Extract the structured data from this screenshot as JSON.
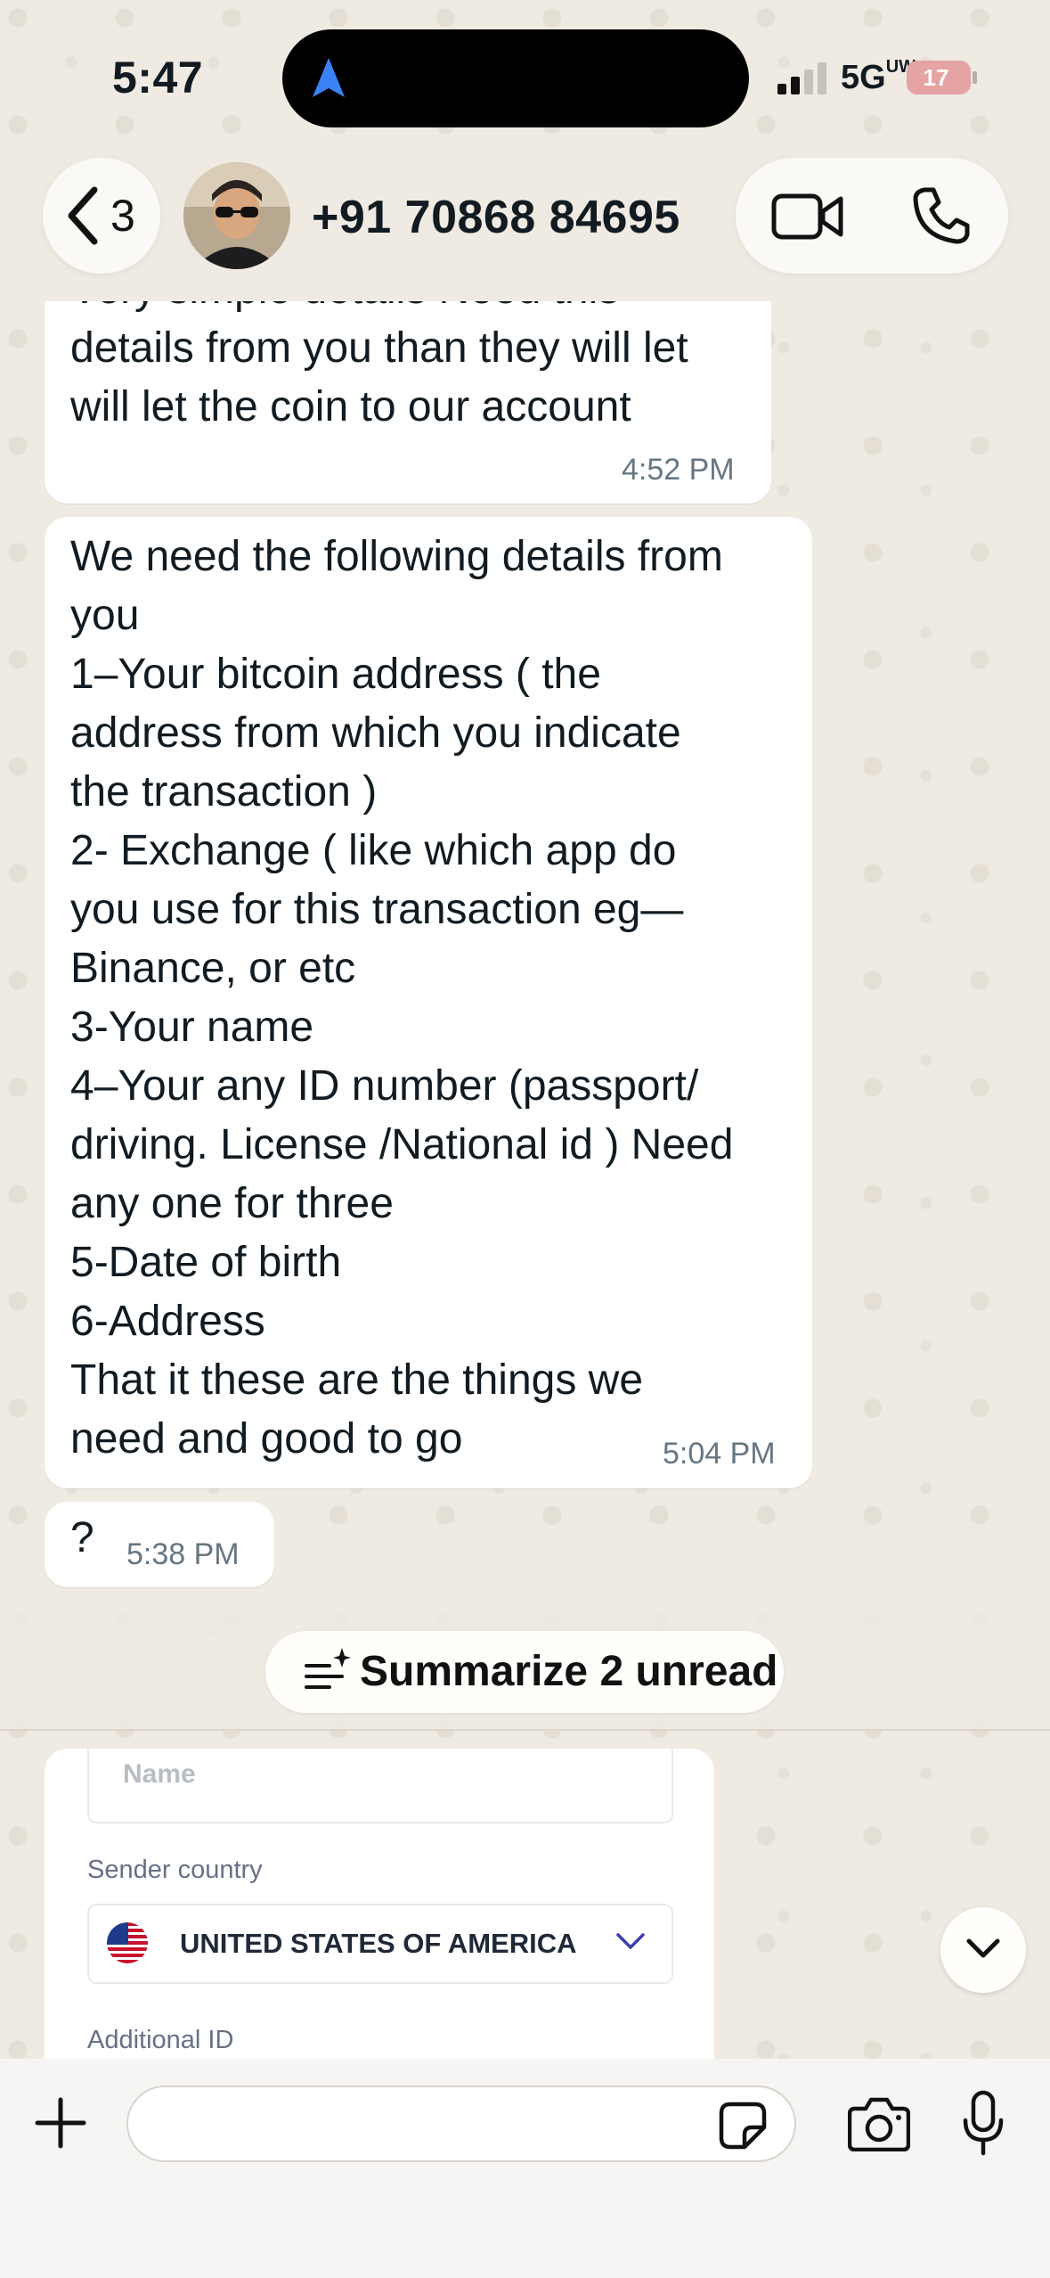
{
  "status_bar": {
    "time": "5:47",
    "network": "5G",
    "network_sub": "UW",
    "battery": "17"
  },
  "header": {
    "back_count": "3",
    "contact_name": "+91 70868 84695"
  },
  "messages": [
    {
      "text": "Very simple details  Need this\ndetails from you than they will let\nwill let the coin to our account",
      "time": "4:52 PM"
    },
    {
      "text": "We need the following details from\nyou\n1–Your bitcoin address ( the\naddress from which you indicate\nthe transaction )\n2- Exchange ( like which app do\nyou use for this transaction eg—\nBinance, or etc\n3-Your name\n4–Your any ID  number (passport/\ndriving. License /National id ) Need\nany one for three\n5-Date of birth\n6-Address\nThat it these are the things we\nneed and good to go",
      "time": "5:04 PM"
    },
    {
      "text": "?",
      "time": "5:38 PM"
    }
  ],
  "summary": {
    "label": "Summarize 2 unread"
  },
  "image_form": {
    "name_placeholder": "Name",
    "sender_country_label": "Sender country",
    "country": "UNITED STATES OF AMERICA",
    "additional_id_label": "Additional ID"
  },
  "composer": {
    "placeholder": ""
  },
  "icons": [
    "chevron-left-icon",
    "video-call-icon",
    "phone-icon",
    "summarize-icon",
    "chevron-down-icon",
    "plus-icon",
    "sticker-icon",
    "camera-icon",
    "microphone-icon",
    "us-flag-icon"
  ],
  "colors": {
    "background": "#efeae2",
    "bubble": "#ffffff",
    "timestamp": "#667781",
    "select_chevron": "#3b3fb0"
  }
}
